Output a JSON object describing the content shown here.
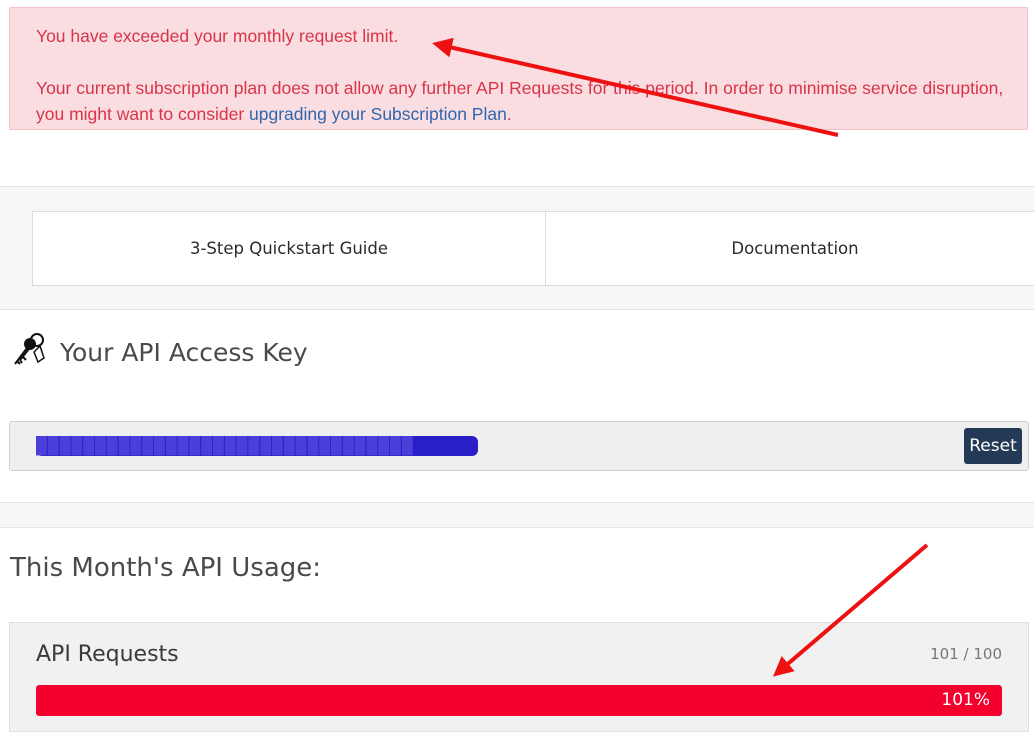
{
  "alert": {
    "line1": "You have exceeded your monthly request limit.",
    "line2_prefix": "Your current subscription plan does not allow any further API Requests for this period. In order to minimise service disruption, you might want to consider ",
    "link_text": "upgrading your Subscription Plan",
    "line2_suffix": ".",
    "color": "#d9344a",
    "background": "#f9dde0"
  },
  "tabs": [
    {
      "label": "3-Step Quickstart Guide"
    },
    {
      "label": "Documentation"
    }
  ],
  "api_key": {
    "title": "Your API Access Key",
    "icon": "keys-icon",
    "reset_label": "Reset",
    "reset_color": "#233a57"
  },
  "usage": {
    "title": "This Month's API Usage:",
    "metric_name": "API Requests",
    "count_text": "101 / 100",
    "percent_text": "101%",
    "used": 101,
    "limit": 100,
    "bar_color": "#f4002d"
  },
  "annotations": {
    "arrow_color": "#ee1111"
  }
}
